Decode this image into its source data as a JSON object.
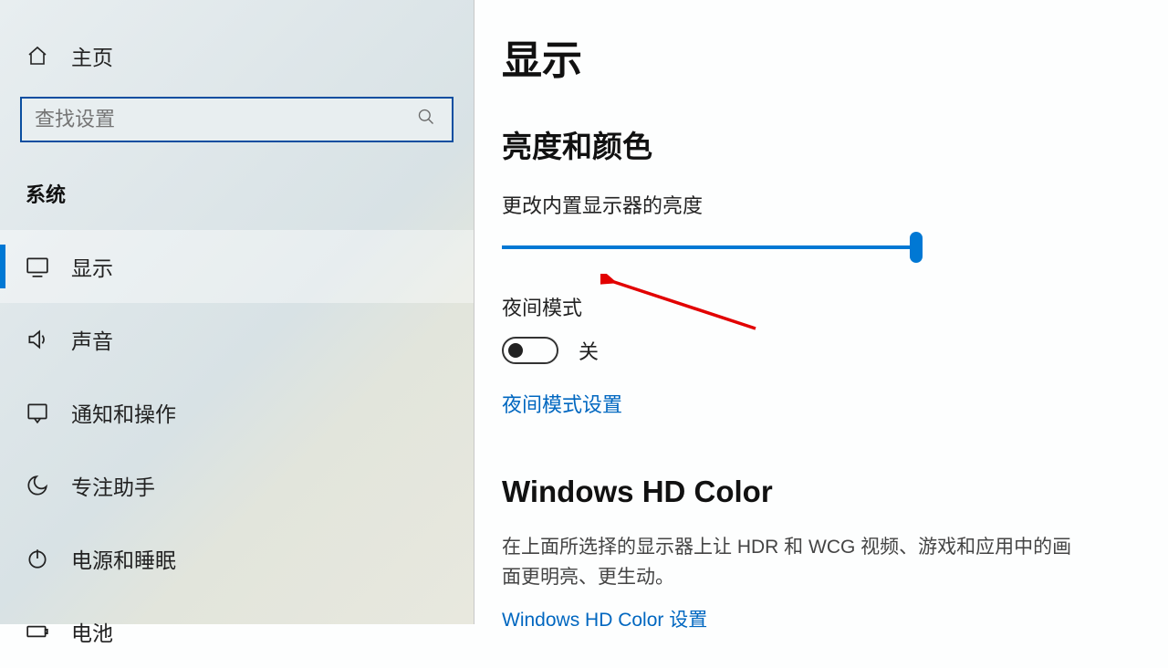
{
  "sidebar": {
    "home_label": "主页",
    "search_placeholder": "查找设置",
    "category_label": "系统",
    "items": [
      {
        "label": "显示",
        "selected": true
      },
      {
        "label": "声音",
        "selected": false
      },
      {
        "label": "通知和操作",
        "selected": false
      },
      {
        "label": "专注助手",
        "selected": false
      },
      {
        "label": "电源和睡眠",
        "selected": false
      },
      {
        "label": "电池",
        "selected": false
      }
    ]
  },
  "main": {
    "page_title": "显示",
    "brightness_section_title": "亮度和颜色",
    "brightness_label": "更改内置显示器的亮度",
    "night_light_label": "夜间模式",
    "night_light_status": "关",
    "night_light_settings_link": "夜间模式设置",
    "hd_color_title": "Windows HD Color",
    "hd_color_desc": "在上面所选择的显示器上让 HDR 和 WCG 视频、游戏和应用中的画面更明亮、更生动。",
    "hd_color_link": "Windows HD Color 设置"
  }
}
